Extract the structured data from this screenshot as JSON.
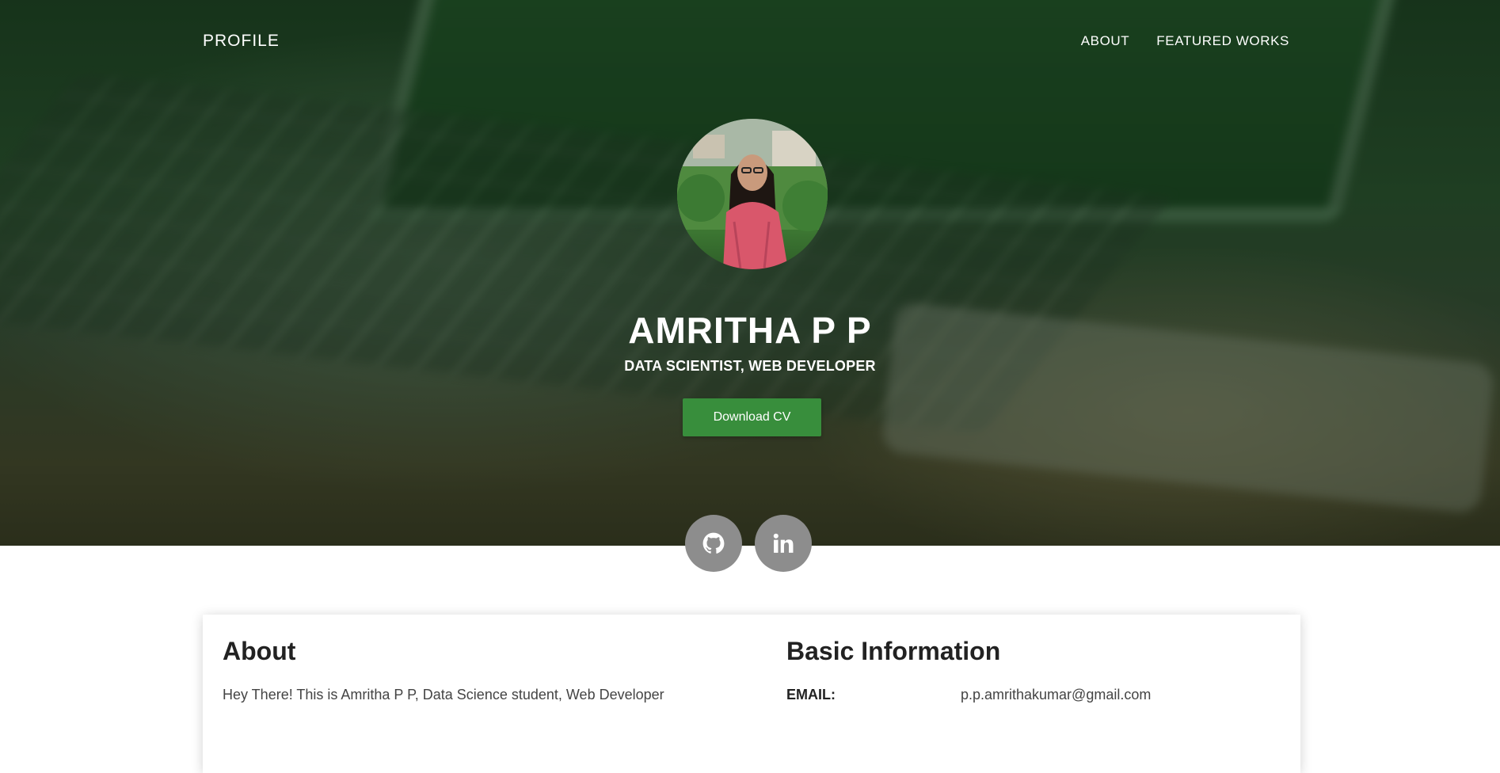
{
  "nav": {
    "brand": "PROFILE",
    "links": [
      "ABOUT",
      "FEATURED WORKS"
    ]
  },
  "hero": {
    "name": "AMRITHA P P",
    "tagline": "DATA SCIENTIST, WEB DEVELOPER",
    "cv_button": "Download CV",
    "avatar_alt": "profile-photo"
  },
  "social": [
    {
      "name": "github",
      "icon": "github-icon"
    },
    {
      "name": "linkedin",
      "icon": "linkedin-icon"
    }
  ],
  "about": {
    "heading": "About",
    "text": "Hey There! This is Amritha P P, Data Science student, Web Developer"
  },
  "basic_info": {
    "heading": "Basic Information",
    "rows": [
      {
        "label": "EMAIL:",
        "value": "p.p.amrithakumar@gmail.com"
      }
    ]
  },
  "colors": {
    "accent": "#388e3c",
    "social_bg": "#8d8d8d"
  }
}
